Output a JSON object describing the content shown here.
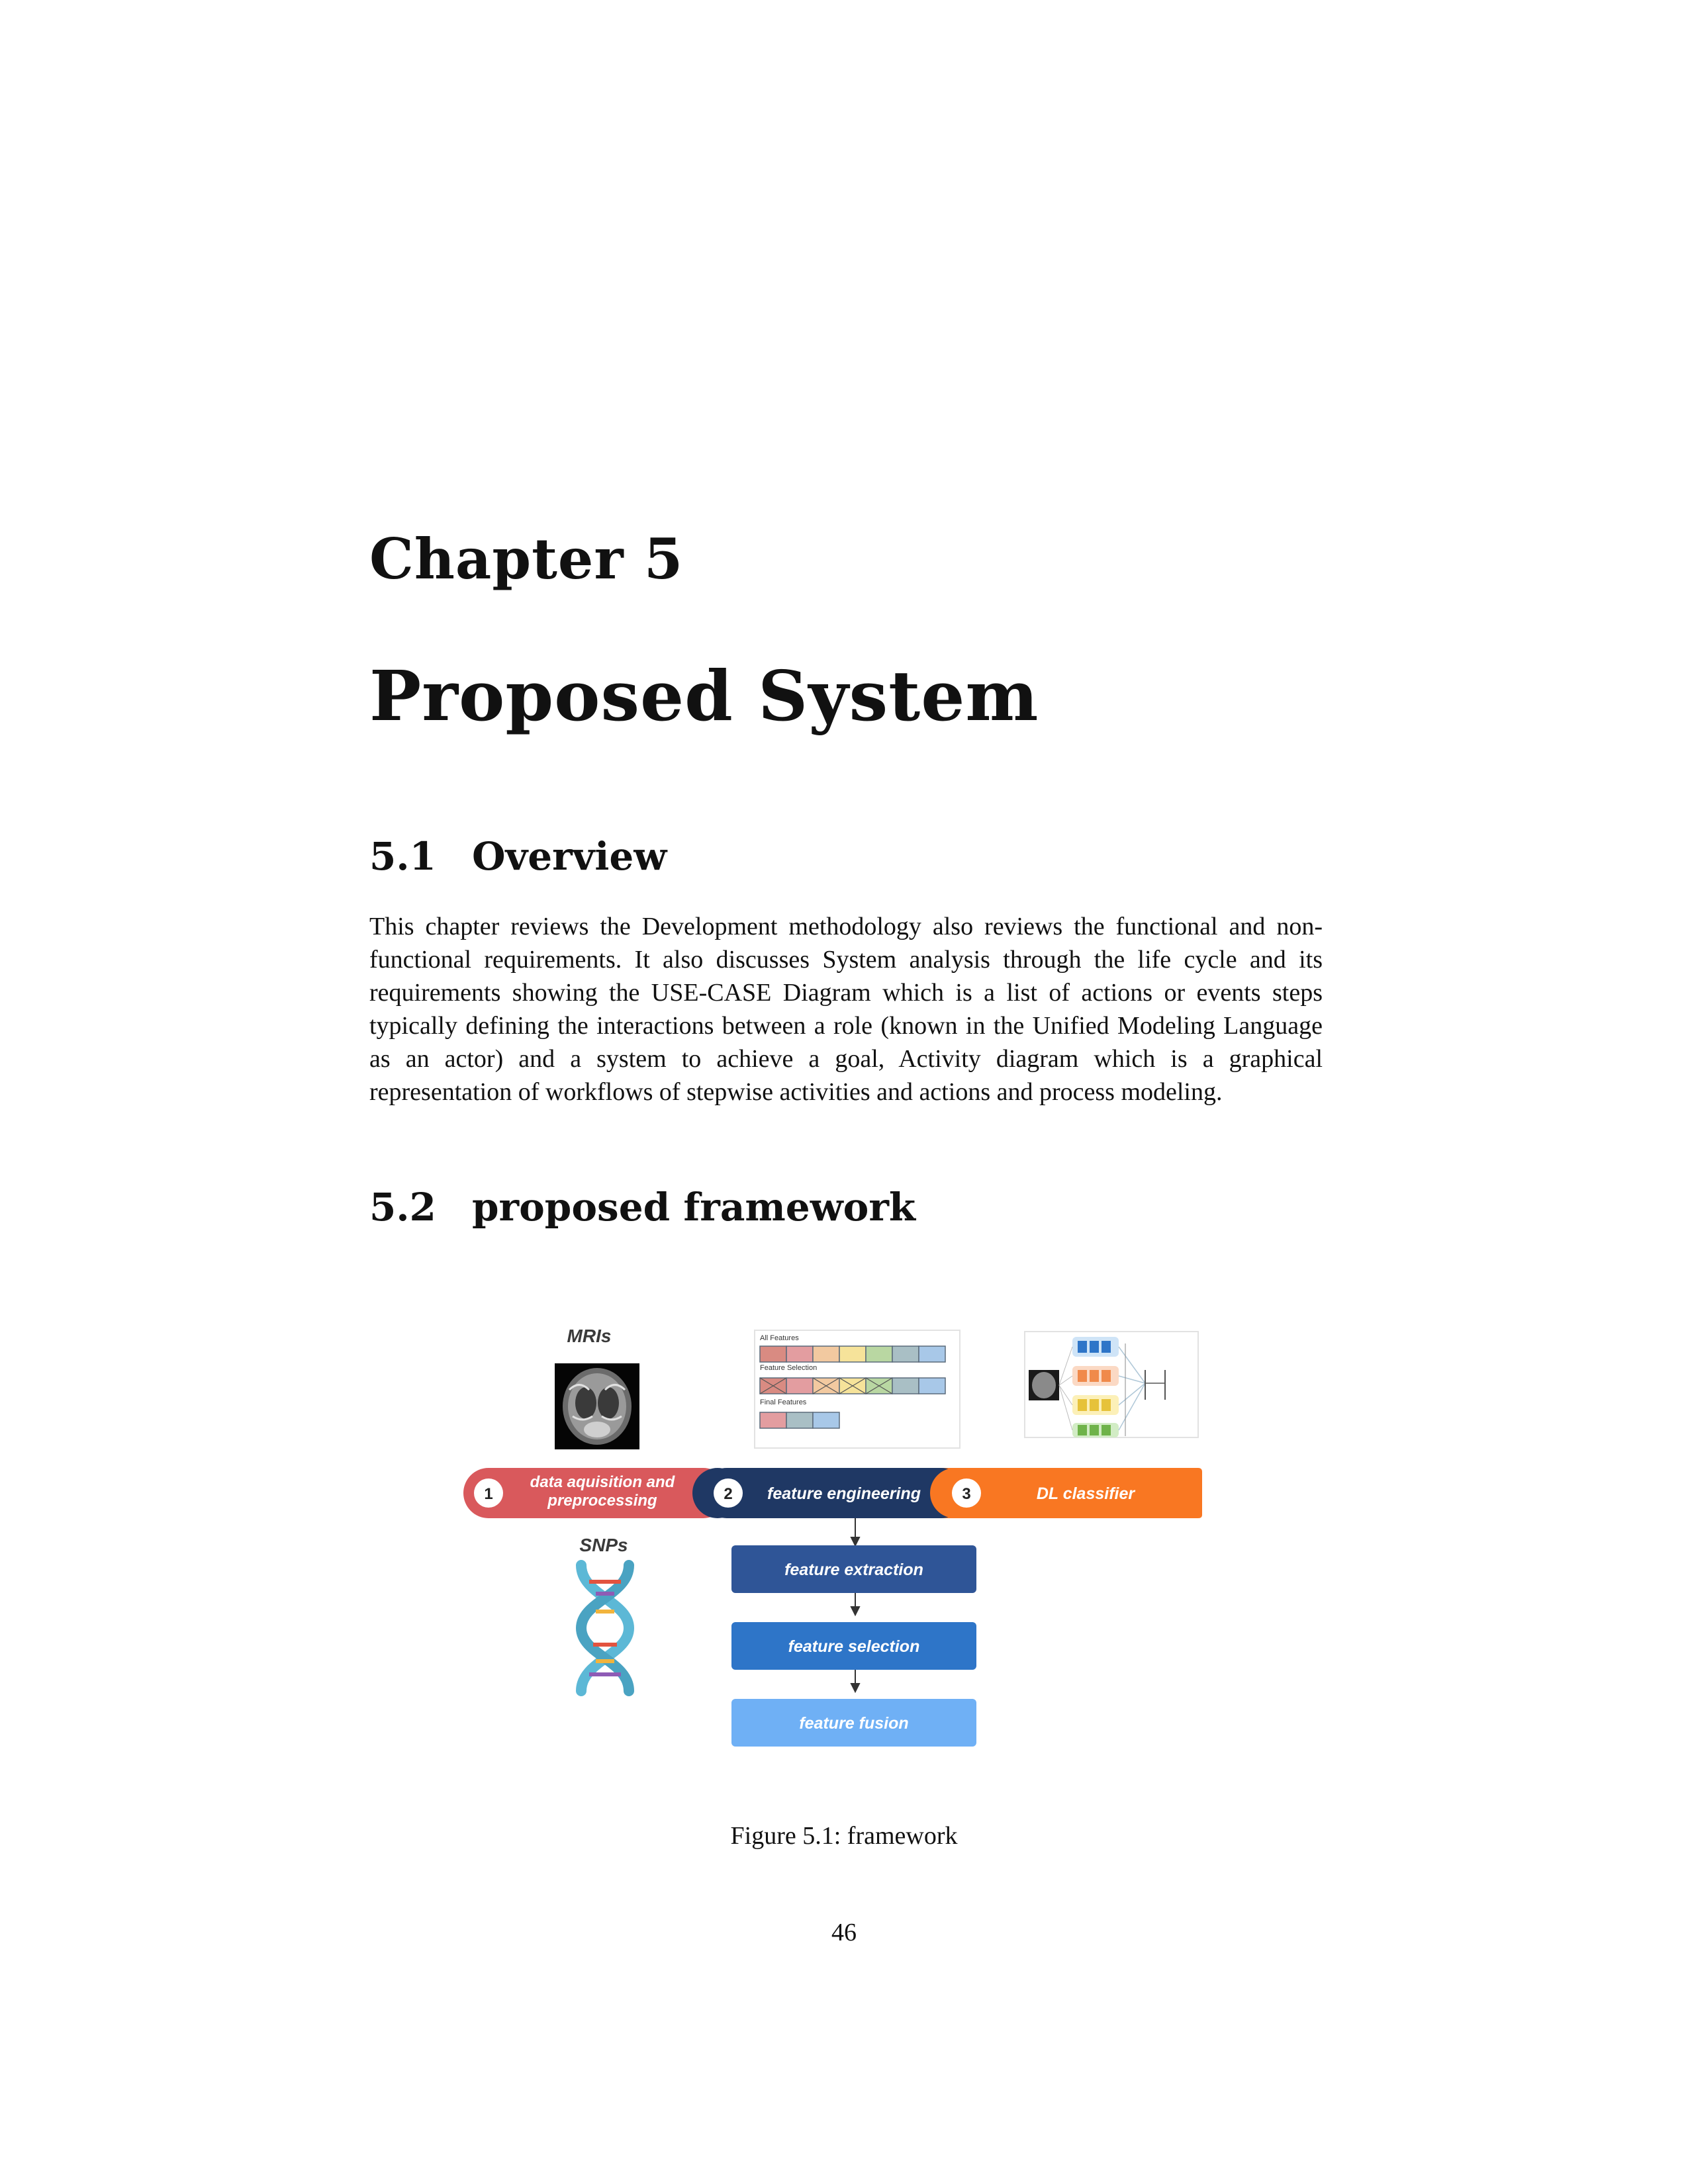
{
  "chapter": {
    "label": "Chapter 5",
    "title": "Proposed System"
  },
  "sections": [
    {
      "number": "5.1",
      "title": "Overview",
      "body": "This chapter reviews the Development methodology also reviews the functional and non-functional requirements. It also discusses System analysis through the life cycle and its requirements showing the USE-CASE Diagram which is a list of actions or events steps typically defining the interactions between a role (known in the Unified Modeling Language as an actor) and a system to achieve a goal, Activity diagram which is a graphical representation of workflows of stepwise activities and actions and process modeling."
    },
    {
      "number": "5.2",
      "title": "proposed framework"
    }
  ],
  "figure": {
    "caption": "Figure 5.1: framework",
    "inputs": {
      "mri_label": "MRIs",
      "snp_label": "SNPs"
    },
    "feature_panel": {
      "all_label": "All Features",
      "selection_label": "Feature Selection",
      "final_label": "Final Features",
      "colors": [
        "#d98b82",
        "#e39da0",
        "#f2c9a0",
        "#f6e39a",
        "#b9d7a2",
        "#a9bfc5",
        "#a8c8e8"
      ]
    },
    "steps": [
      {
        "number": "1",
        "label_line1": "data aquisition and",
        "label_line2": "preprocessing",
        "color": "#d9595c"
      },
      {
        "number": "2",
        "label": "feature engineering",
        "color": "#1f3864"
      },
      {
        "number": "3",
        "label": "DL classifier",
        "color": "#f97722"
      }
    ],
    "substeps": [
      {
        "label": "feature extraction",
        "color": "#2f5597"
      },
      {
        "label": "feature selection",
        "color": "#2e75c8"
      },
      {
        "label": "feature fusion",
        "color": "#6fb0f5"
      }
    ],
    "icons": [
      "brain-mri-icon",
      "dna-helix-icon",
      "neural-network-icon"
    ]
  },
  "page_number": "46"
}
